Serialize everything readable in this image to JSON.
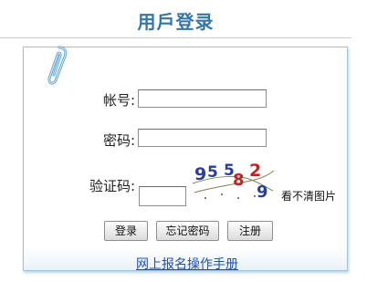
{
  "page": {
    "title": "用戶登录"
  },
  "form": {
    "account_label": "帐号:",
    "account_value": "",
    "password_label": "密码:",
    "password_value": "",
    "captcha_label": "验证码:",
    "captcha_value": "",
    "captcha_chars": [
      "9",
      "5",
      "5",
      "8",
      "2",
      "9"
    ],
    "captcha_refresh": "看不清图片"
  },
  "buttons": {
    "login": "登录",
    "forgot": "忘记密码",
    "register": "注册"
  },
  "links": {
    "manual": "网上报名操作手册"
  },
  "colors": {
    "title": "#3576a8",
    "border": "#9cc3de",
    "link": "#1f4fb3",
    "captcha_text": "#2a3f9a",
    "captcha_accent": "#c82020"
  },
  "icons": {
    "clip": "paperclip-icon"
  }
}
